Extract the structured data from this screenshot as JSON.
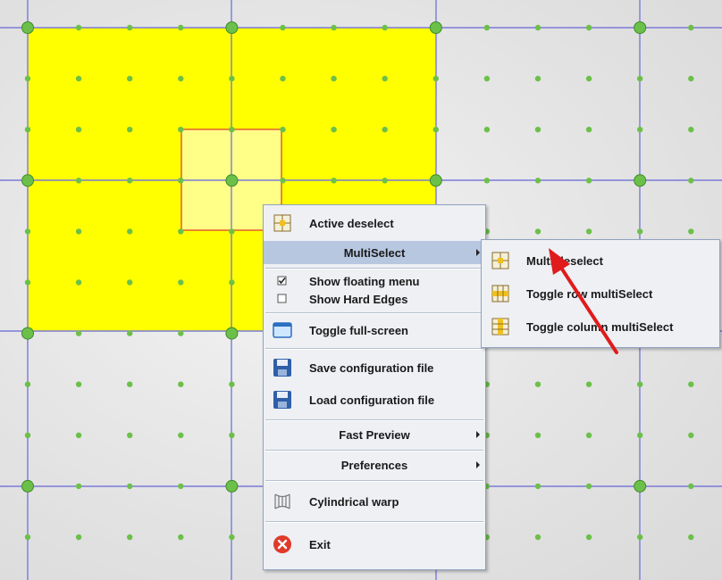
{
  "menu": {
    "items": [
      {
        "label": "Active deselect",
        "icon": "grid-cell-icon"
      },
      {
        "label": "MultiSelect",
        "highlighted": true,
        "submenu": true
      },
      {
        "label": "Show floating menu",
        "checkbox": true,
        "checked": true
      },
      {
        "label": "Show Hard Edges",
        "checkbox": true,
        "checked": false
      },
      {
        "label": "Toggle full-screen",
        "icon": "window-icon"
      },
      {
        "label": "Save configuration file",
        "icon": "floppy-disk-icon"
      },
      {
        "label": "Load configuration file",
        "icon": "floppy-disk-icon"
      },
      {
        "label": "Fast Preview",
        "submenu": true
      },
      {
        "label": "Preferences",
        "submenu": true
      },
      {
        "label": "Cylindrical warp",
        "icon": "cylinder-icon"
      },
      {
        "label": "Exit",
        "icon": "close-circle-icon"
      }
    ]
  },
  "submenu": {
    "items": [
      {
        "label": "Multi deselect",
        "icon": "grid-cell-icon"
      },
      {
        "label": "Toggle row multiSelect",
        "icon": "grid-row-icon"
      },
      {
        "label": "Toggle column multiSelect",
        "icon": "grid-column-icon"
      }
    ]
  },
  "colors": {
    "selection_fill": "#ffff00",
    "inner_cell_fill": "#ffff88",
    "inner_cell_border": "#e06030",
    "grid_line": "#7a7ad8",
    "node_dot": "#6cc04a",
    "menu_highlight": "#b7c7e0",
    "pointer_arrow": "#e01b1b"
  }
}
